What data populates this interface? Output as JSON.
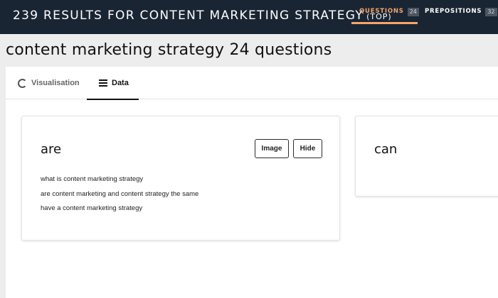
{
  "header": {
    "title": "239 RESULTS FOR CONTENT MARKETING STRATEGY",
    "title_suffix": "(TOP)",
    "tabs": [
      {
        "label": "QUESTIONS",
        "count": "24",
        "active": true
      },
      {
        "label": "PREPOSITIONS",
        "count": "32",
        "active": false
      }
    ]
  },
  "page": {
    "heading": "content marketing strategy 24 questions"
  },
  "view_tabs": [
    {
      "label": "Visualisation",
      "icon": "ring-chart-icon",
      "active": false
    },
    {
      "label": "Data",
      "icon": "list-icon",
      "active": true
    }
  ],
  "cards": [
    {
      "title": "are",
      "buttons": {
        "image": "Image",
        "hide": "Hide"
      },
      "questions": [
        "what is content marketing strategy",
        "are content marketing and content strategy the same",
        "have a content marketing strategy"
      ]
    },
    {
      "title": "can"
    }
  ],
  "colors": {
    "header_bg": "#1a2533",
    "accent": "#f5a56b",
    "page_bg": "#ededed"
  }
}
